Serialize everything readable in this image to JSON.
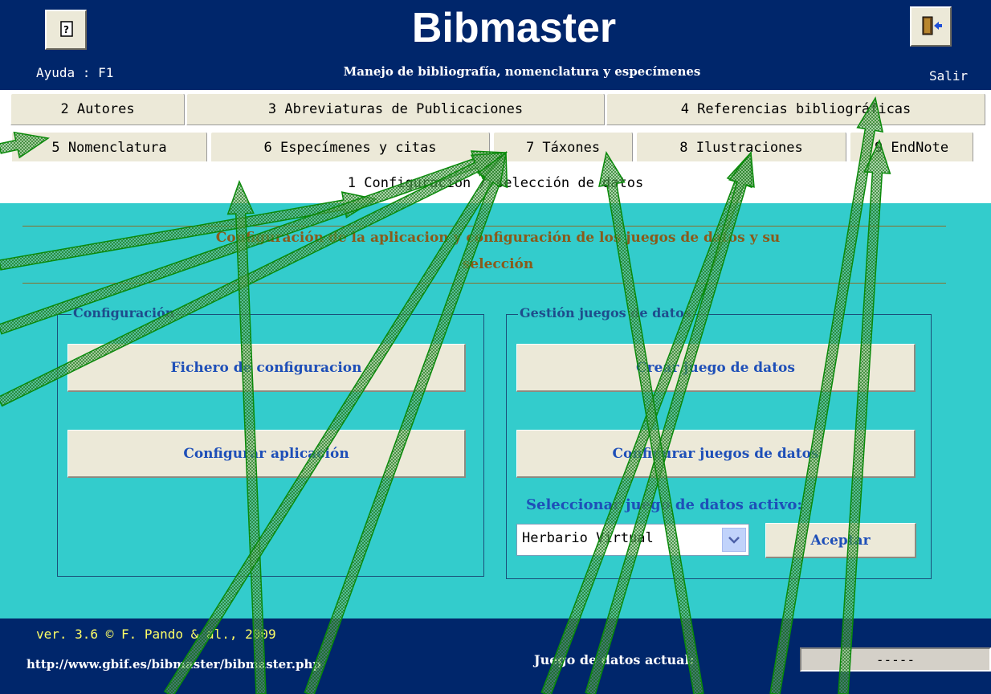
{
  "header": {
    "title": "Bibmaster",
    "subtitle": "Manejo de bibliografía, nomenclatura y especímenes",
    "help_label": "Ayuda : F1",
    "exit_label": "Salir",
    "bg_color": "#00266b"
  },
  "tabs": {
    "row1": [
      {
        "label": "2 Autores"
      },
      {
        "label": "3 Abreviaturas de Publicaciones"
      },
      {
        "label": "4 Referencias bibliográficas"
      }
    ],
    "row2": [
      {
        "label": "5 Nomenclatura"
      },
      {
        "label": "6 Especímenes y citas"
      },
      {
        "label": "7 Táxones"
      },
      {
        "label": "8 Ilustraciones"
      },
      {
        "label": "9 EndNote"
      }
    ],
    "active": "1 Configuración / selección de datos"
  },
  "main": {
    "section_title_line1": "Configuración de la aplicacion y configuración de los juegos de datos y su",
    "section_title_line2": "selección",
    "config_group": {
      "legend": "Configuración",
      "btn_config_file": "Fichero de configuracion",
      "btn_config_app": "Configurar aplicación"
    },
    "datasets_group": {
      "legend": "Gestión juegos de datos",
      "btn_create": "Crear juego de datos",
      "btn_configure": "Configurar juegos de datos",
      "select_label": "Seleccionar juego de datos activo:",
      "select_value": "Herbario Virtual",
      "accept_label": "Aceptar"
    },
    "bg_color": "#33cccc"
  },
  "footer": {
    "version": "ver. 3.6  © F. Pando & al., 2009",
    "url": "http://www.gbif.es/bibmaster/bibmaster.php",
    "dataset_label": "Juego de datos actual:",
    "dataset_value": "-----"
  },
  "annotation": {
    "arrow_color": "#0a8a0a"
  }
}
